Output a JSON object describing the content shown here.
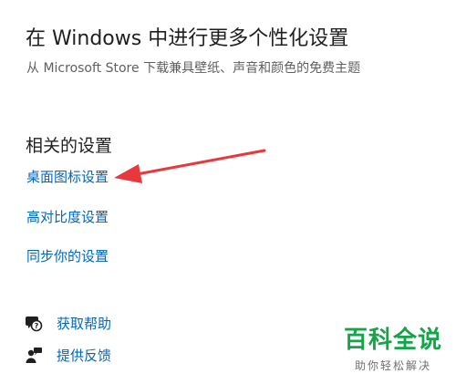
{
  "personalize": {
    "title": "在 Windows 中进行更多个性化设置",
    "subtitle": "从 Microsoft Store 下载兼具壁纸、声音和颜色的免费主题"
  },
  "related": {
    "title": "相关的设置",
    "links": [
      "桌面图标设置",
      "高对比度设置",
      "同步你的设置"
    ]
  },
  "help": {
    "get_help_label": "获取帮助",
    "get_help_icon": "chat-help-icon",
    "feedback_label": "提供反馈",
    "feedback_icon": "feedback-person-icon"
  },
  "annotation": {
    "arrow_color": "#e8383d"
  },
  "watermark": {
    "title": "百科全说",
    "subtitle": "助你轻松解决",
    "color": "#16a34a"
  },
  "colors": {
    "link": "#0067c0",
    "text": "#1f1f1f",
    "muted": "#5f5f5f"
  }
}
